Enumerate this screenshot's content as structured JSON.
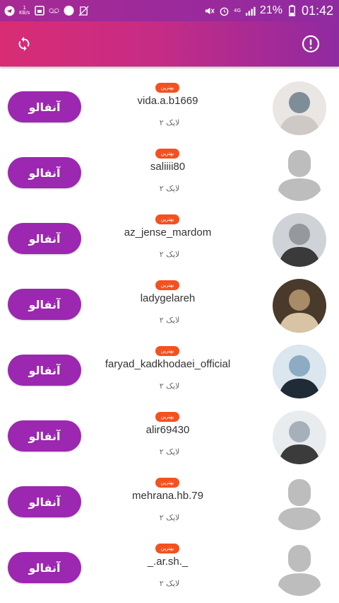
{
  "status_bar": {
    "battery_percent": "21%",
    "time": "01:42",
    "network_type": "4G",
    "speed_value": "1",
    "speed_unit": "KB/s",
    "notification_count": "1"
  },
  "toolbar": {
    "refresh_icon": "refresh-icon",
    "info_icon": "info-icon"
  },
  "colors": {
    "toolbar_start": "#d92c74",
    "toolbar_end": "#8f2aa2",
    "button": "#9c27b0",
    "badge": "#f4511e"
  },
  "users": [
    {
      "username": "vida.a.b1669",
      "likes": "۲ لایک",
      "badge": "بهترین",
      "button": "آنفالو",
      "avatar": "photo"
    },
    {
      "username": "saliiii80",
      "likes": "۲ لایک",
      "badge": "بهترین",
      "button": "آنفالو",
      "avatar": "default"
    },
    {
      "username": "az_jense_mardom",
      "likes": "۲ لایک",
      "badge": "بهترین",
      "button": "آنفالو",
      "avatar": "photo"
    },
    {
      "username": "ladygelareh",
      "likes": "۲ لایک",
      "badge": "بهترین",
      "button": "آنفالو",
      "avatar": "photo"
    },
    {
      "username": "faryad_kadkhodaei_official",
      "likes": "۲ لایک",
      "badge": "بهترین",
      "button": "آنفالو",
      "avatar": "photo"
    },
    {
      "username": "alir69430",
      "likes": "۲ لایک",
      "badge": "بهترین",
      "button": "آنفالو",
      "avatar": "photo"
    },
    {
      "username": "mehrana.hb.79",
      "likes": "۲ لایک",
      "badge": "بهترین",
      "button": "آنفالو",
      "avatar": "default"
    },
    {
      "username": "_.ar.sh._",
      "likes": "۲ لایک",
      "badge": "بهترین",
      "button": "آنفالو",
      "avatar": "default"
    }
  ]
}
